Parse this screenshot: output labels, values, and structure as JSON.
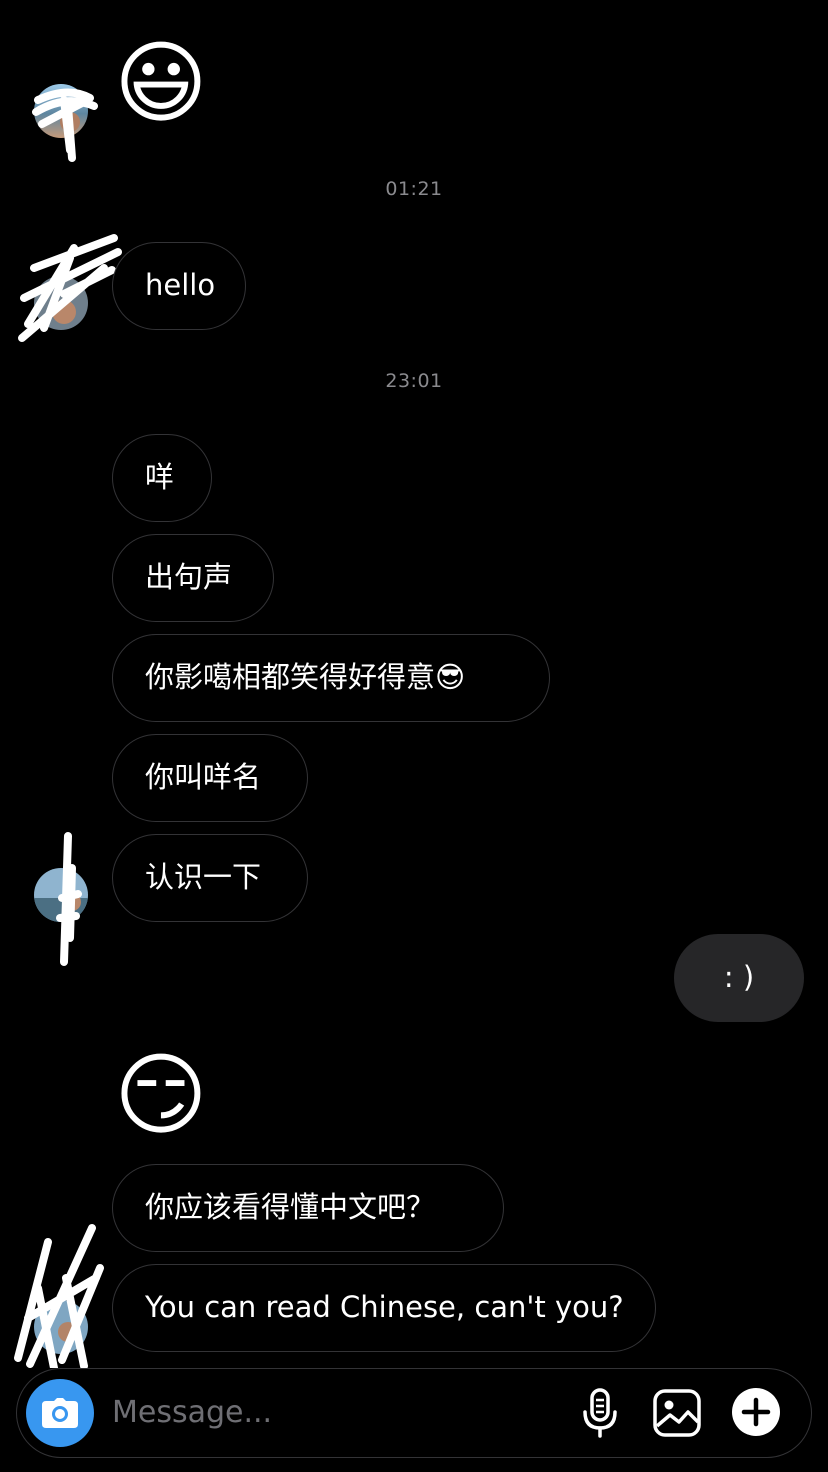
{
  "conversation": {
    "timestamps": [
      "01:21",
      "23:01"
    ],
    "received": {
      "big_emoji_1": "😃",
      "hello": "hello",
      "msg_1": "咩",
      "msg_2": "出句声",
      "msg_3": "你影噶相都笑得好得意😎",
      "msg_4": "你叫咩名",
      "msg_5": "认识一下",
      "big_emoji_2": "😏",
      "msg_6": "你应该看得懂中文吧？",
      "msg_7": "You can read Chinese, can't you?"
    },
    "sent": {
      "msg_1": ": )"
    }
  },
  "composer": {
    "placeholder": "Message...",
    "value": "",
    "icons": [
      "camera-icon",
      "microphone-icon",
      "gallery-icon",
      "plus-icon"
    ]
  },
  "colors": {
    "background": "#000000",
    "bubble_border": "#333336",
    "sent_bubble": "#262628",
    "accent": "#3897f0",
    "timestamp": "#8a8a8e"
  }
}
